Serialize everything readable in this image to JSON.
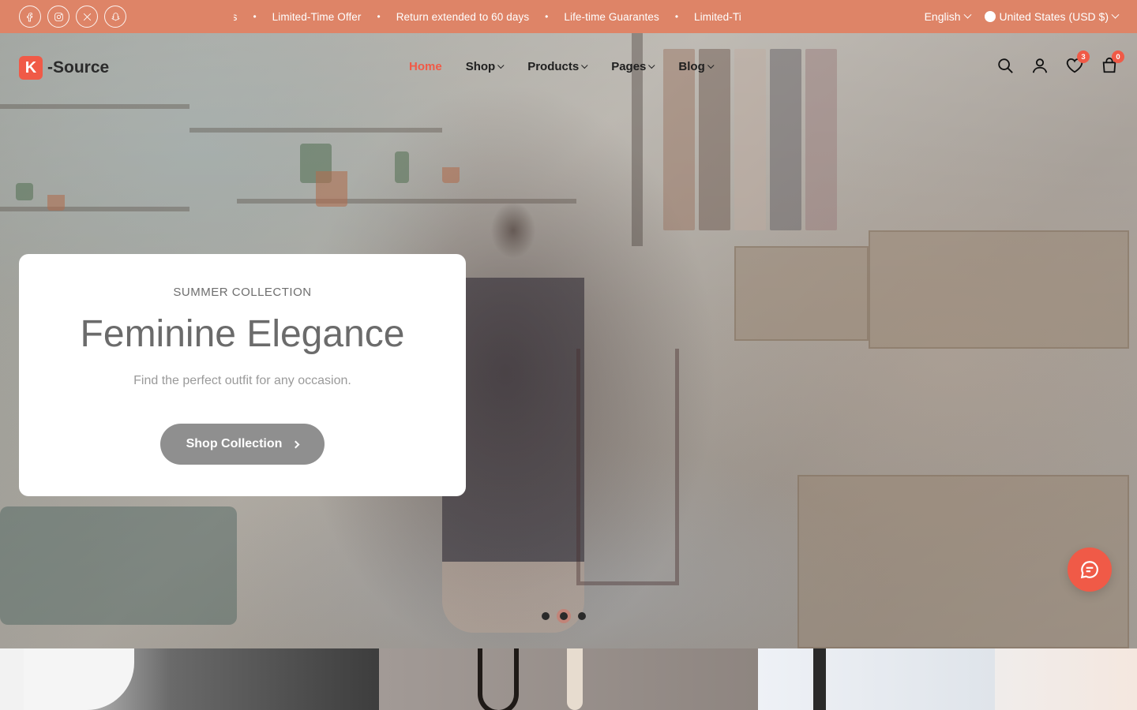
{
  "topbar": {
    "socials": [
      {
        "icon": "facebook-icon"
      },
      {
        "icon": "instagram-icon"
      },
      {
        "icon": "x-icon"
      },
      {
        "icon": "snapchat-icon"
      }
    ],
    "ticker": [
      "es",
      "Limited-Time Offer",
      "Return extended to 60 days",
      "Life-time Guarantes",
      "Limited-Ti"
    ],
    "language": "English",
    "currency": "United States (USD $)"
  },
  "header": {
    "logo_letter": "K",
    "logo_text": "-Source",
    "nav": [
      "Home",
      "Shop",
      "Products",
      "Pages",
      "Blog"
    ],
    "wishlist_count": "3",
    "cart_count": "0"
  },
  "hero": {
    "eyebrow": "SUMMER COLLECTION",
    "title": "Feminine Elegance",
    "subtitle": "Find the perfect outfit for any occasion.",
    "cta": "Shop Collection",
    "slides_total": 3,
    "active_slide": 1
  },
  "colors": {
    "topbar_bg": "#de8467",
    "accent": "#f05a47"
  }
}
